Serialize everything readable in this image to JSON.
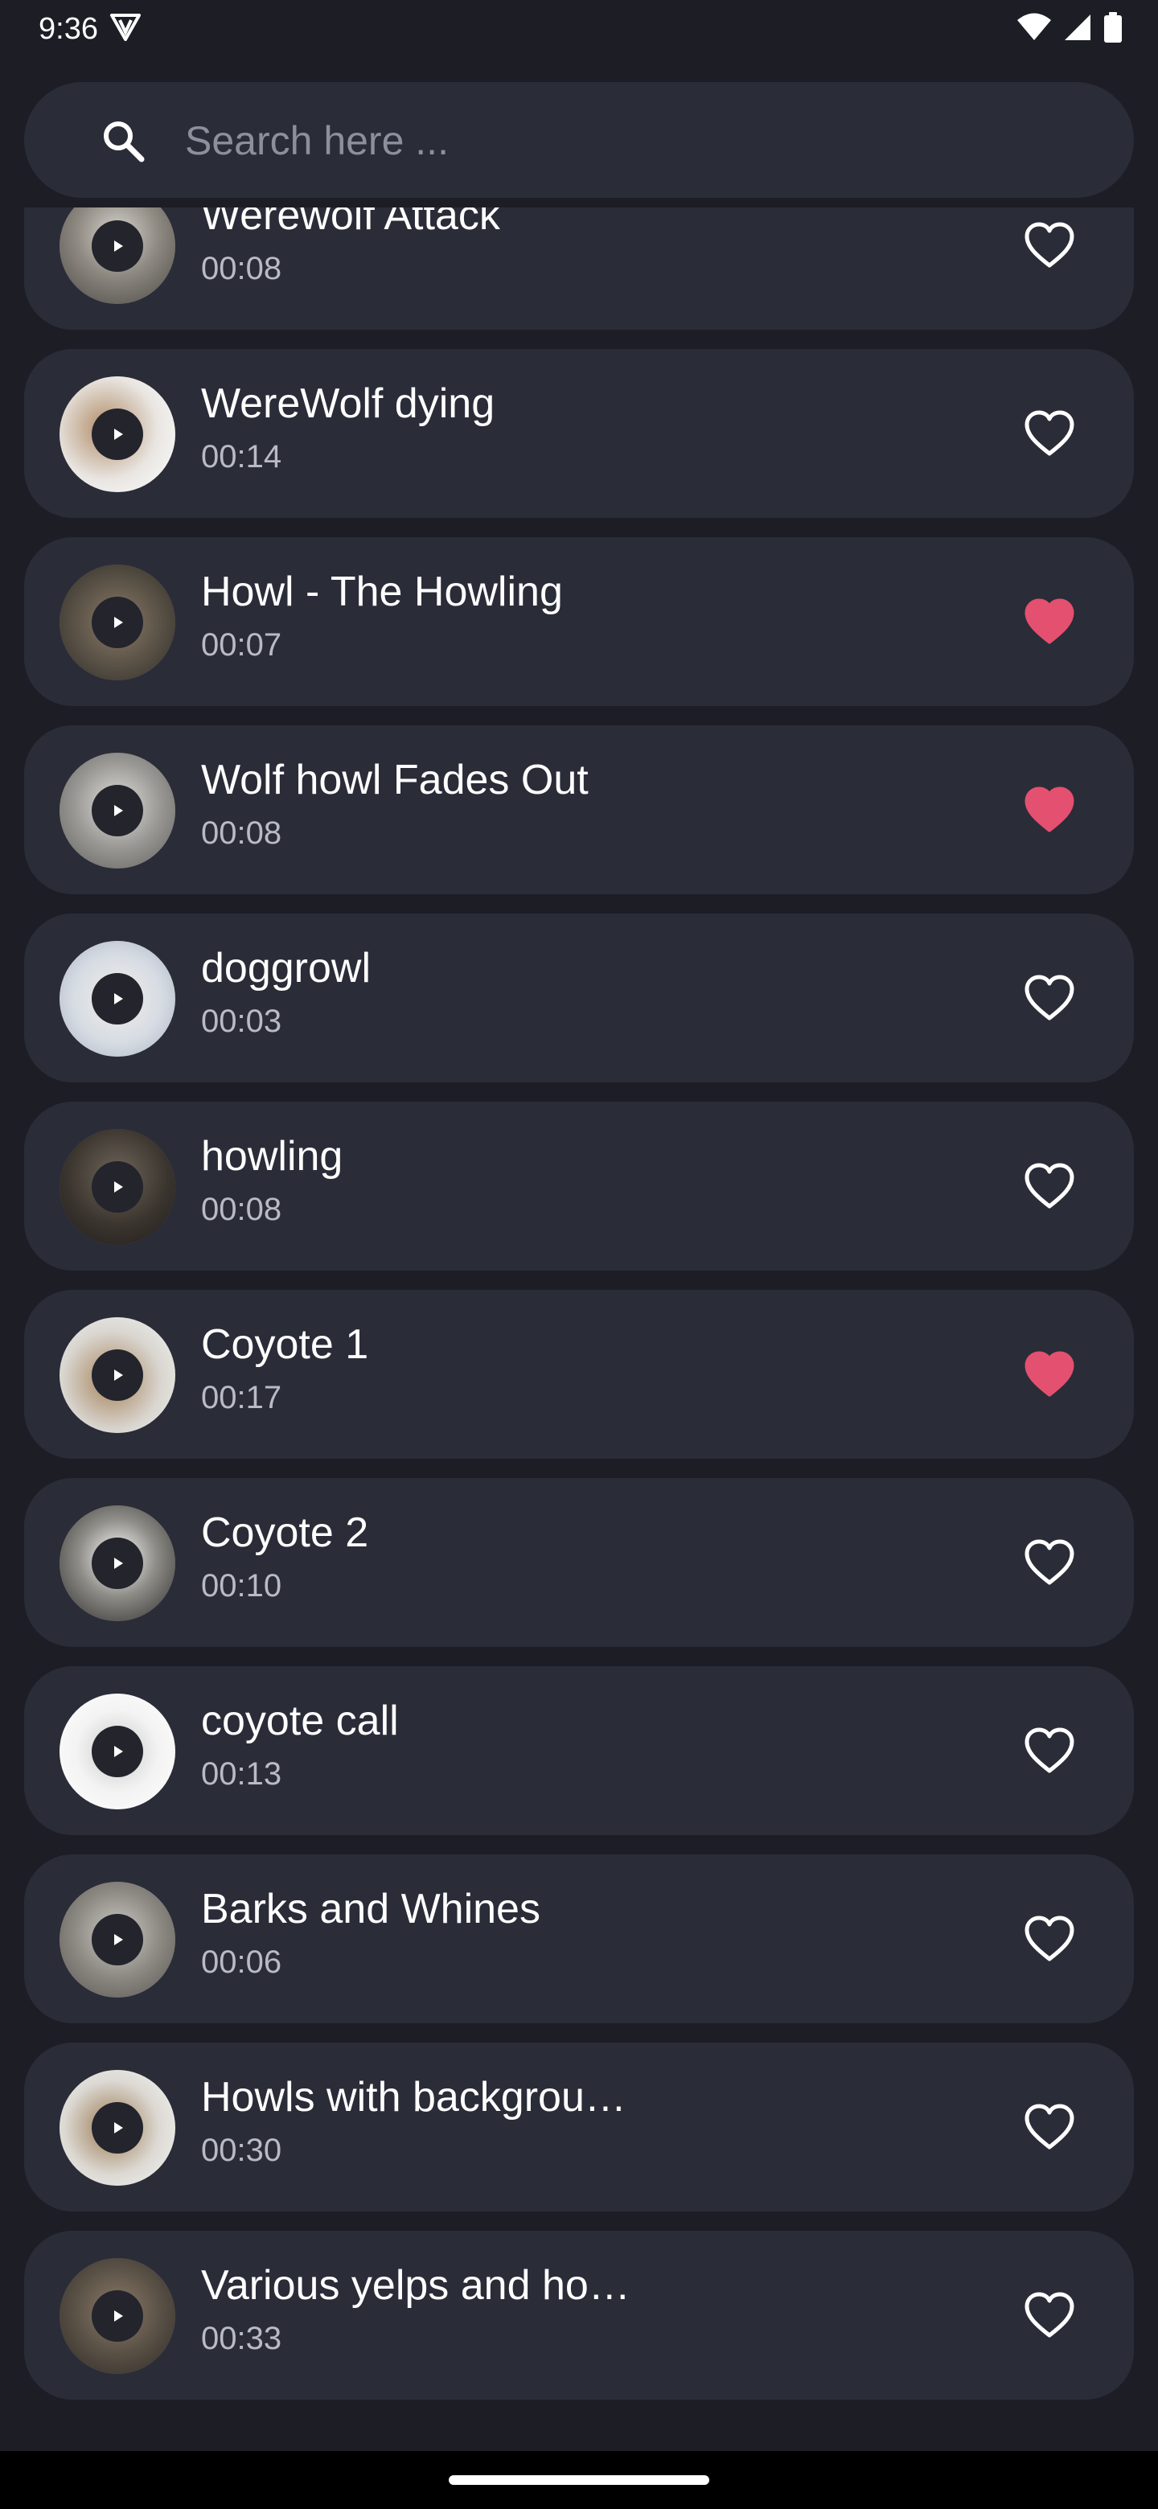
{
  "status_bar": {
    "time": "9:36",
    "icons": [
      "vpn-shield-icon",
      "wifi-icon",
      "signal-icon",
      "battery-icon"
    ]
  },
  "search": {
    "placeholder": "Search here ...",
    "value": "",
    "icon": "search-icon"
  },
  "colors": {
    "background": "#1c1d25",
    "card": "#2a2c38",
    "heart_filled": "#e4506f",
    "text_secondary": "#b9bac4"
  },
  "sounds": [
    {
      "title": "Werewolf Attack",
      "duration": "00:08",
      "favorite": false
    },
    {
      "title": "WereWolf dying",
      "duration": "00:14",
      "favorite": false
    },
    {
      "title": "Howl - The Howling",
      "duration": "00:07",
      "favorite": true
    },
    {
      "title": "Wolf howl Fades Out",
      "duration": "00:08",
      "favorite": true
    },
    {
      "title": "doggrowl",
      "duration": "00:03",
      "favorite": false
    },
    {
      "title": "howling",
      "duration": "00:08",
      "favorite": false
    },
    {
      "title": "Coyote 1",
      "duration": "00:17",
      "favorite": true
    },
    {
      "title": "Coyote 2",
      "duration": "00:10",
      "favorite": false
    },
    {
      "title": "coyote call",
      "duration": "00:13",
      "favorite": false
    },
    {
      "title": "Barks and Whines",
      "duration": "00:06",
      "favorite": false
    },
    {
      "title": "Howls with backgrou…",
      "duration": "00:30",
      "favorite": false
    },
    {
      "title": "Various yelps and ho…",
      "duration": "00:33",
      "favorite": false
    }
  ]
}
